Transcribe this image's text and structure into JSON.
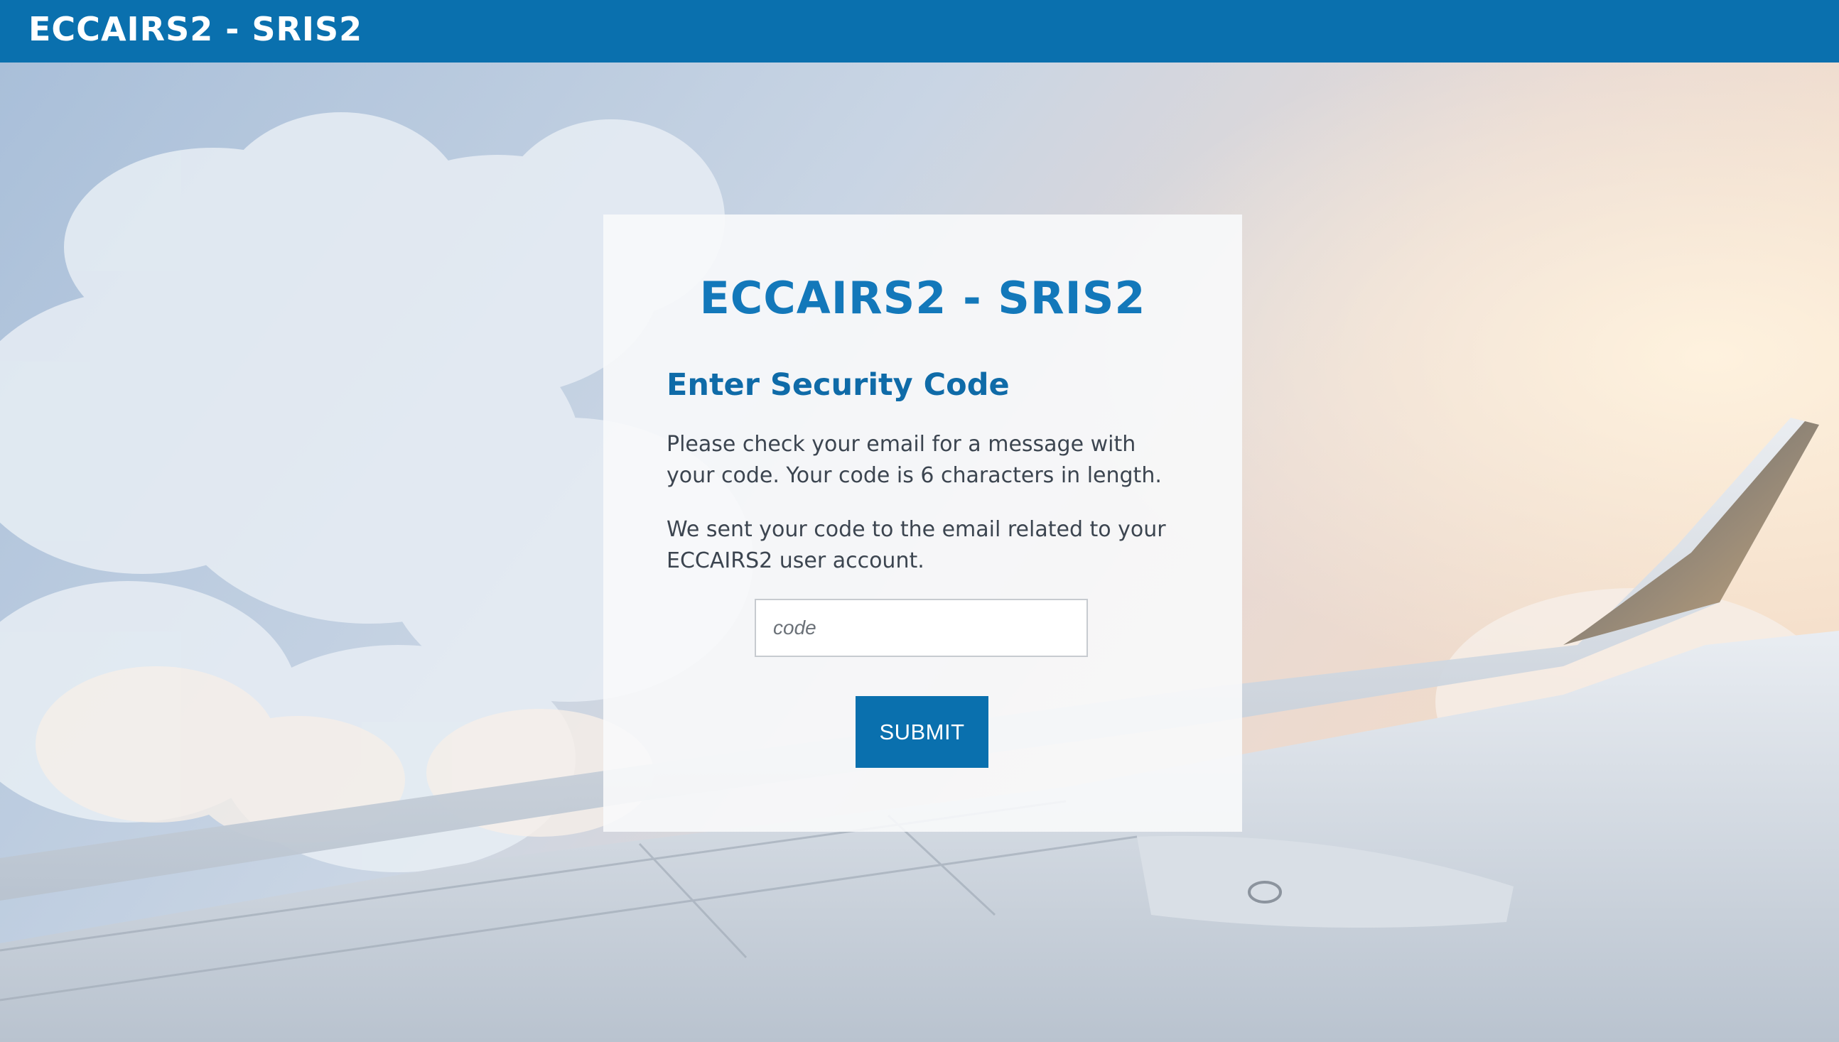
{
  "header": {
    "logo_text": "ECCAIRS2 - SRIS2"
  },
  "card": {
    "logo_text": "ECCAIRS2 - SRIS2",
    "title": "Enter Security Code",
    "message_1": "Please check your email for a message with your code. Your code is 6 characters in length.",
    "message_2": "We sent your code to the email related to your ECCAIRS2 user account.",
    "code_input": {
      "value": "",
      "placeholder": "code"
    },
    "submit_label": "SUBMIT"
  },
  "colors": {
    "header_bg": "#0a70ae",
    "accent": "#1378ba",
    "title": "#0f6ba8",
    "button_bg": "#0a70ae",
    "text": "#3c4550"
  }
}
